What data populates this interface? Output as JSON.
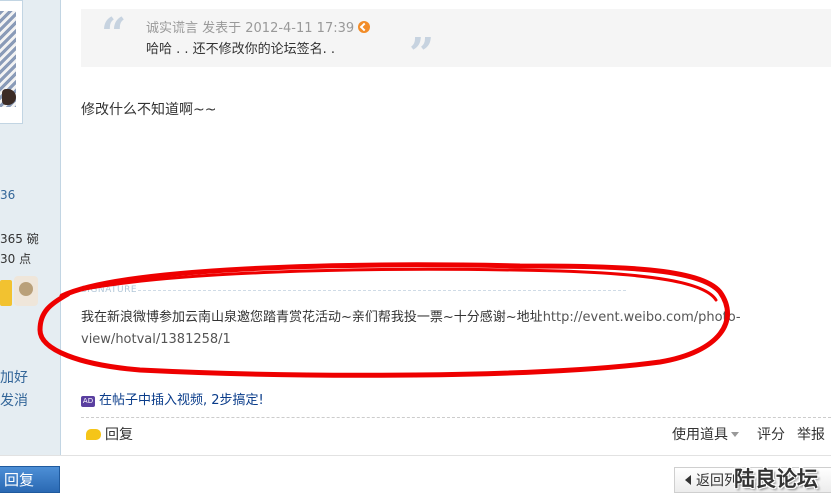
{
  "sidebar": {
    "stat_1": "36",
    "stat_2": "365 碗",
    "stat_3": "30 点",
    "link_add_friend": "加好",
    "link_send_msg": "发消"
  },
  "quote": {
    "author": "诚实谎言 发表于 2012-4-11 17:39",
    "text": "哈哈 . . 还不修改你的论坛签名. ."
  },
  "post": {
    "body": "修改什么不知道啊~~"
  },
  "signature": {
    "label": "SIGNATURE",
    "text": "我在新浪微博参加云南山泉邀您踏青赏花活动~亲们帮我投一票~十分感谢~地址",
    "url": "http://event.weibo.com/photo-view/hotval/1381258/1"
  },
  "promo": {
    "badge": "AD",
    "text": "在帖子中插入视频, 2步搞定!"
  },
  "actions": {
    "reply": "回复",
    "use_tool": "使用道具",
    "rate": "评分",
    "report": "举报"
  },
  "bottom": {
    "reply_button": "回复",
    "back_button": "返回列表",
    "watermark": "陆良论坛"
  },
  "colors": {
    "annotation_red": "#ee0000",
    "link_blue": "#336699",
    "reply_button": "#2a69b3"
  }
}
